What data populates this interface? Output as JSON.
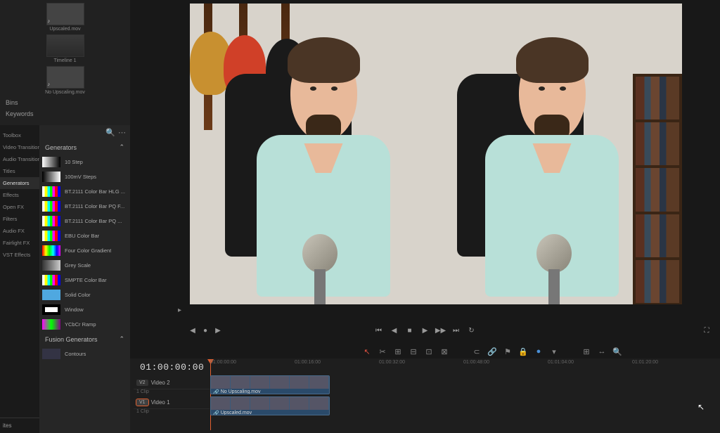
{
  "media_pool": {
    "items": [
      {
        "name": "Upscaled.mov",
        "type": "video"
      },
      {
        "name": "Timeline 1",
        "type": "timeline"
      },
      {
        "name": "No Upscaling.mov",
        "type": "video"
      }
    ]
  },
  "filters": {
    "bins": "Bins",
    "keywords": "Keywords"
  },
  "categories": [
    "Toolbox",
    "Video Transitions",
    "Audio Transitions",
    "Titles",
    "Generators",
    "Effects",
    "Open FX",
    "Filters",
    "Audio FX",
    "Fairlight FX",
    "VST Effects"
  ],
  "active_category": "Generators",
  "generators_header": "Generators",
  "fusion_gen_header": "Fusion Generators",
  "contours_item": "Contours",
  "bottom_tab": "ites",
  "generators": [
    {
      "label": "10 Step",
      "swatch": "swatch-10step"
    },
    {
      "label": "100mV Steps",
      "swatch": "swatch-100mv"
    },
    {
      "label": "BT.2111 Color Bar HLG ...",
      "swatch": "swatch-bars"
    },
    {
      "label": "BT.2111 Color Bar PQ F...",
      "swatch": "swatch-bars"
    },
    {
      "label": "BT.2111 Color Bar PQ ...",
      "swatch": "swatch-bars"
    },
    {
      "label": "EBU Color Bar",
      "swatch": "swatch-bars"
    },
    {
      "label": "Four Color Gradient",
      "swatch": "swatch-gradient"
    },
    {
      "label": "Grey Scale",
      "swatch": "swatch-grey"
    },
    {
      "label": "SMPTE Color Bar",
      "swatch": "swatch-bars"
    },
    {
      "label": "Solid Color",
      "swatch": "swatch-solid"
    },
    {
      "label": "Window",
      "swatch": "swatch-window"
    },
    {
      "label": "YCbCr Ramp",
      "swatch": "swatch-ycocg"
    }
  ],
  "timecode": "01:00:00:00",
  "tracks": {
    "v2": {
      "badge": "V2",
      "name": "Video 2",
      "sub": "1 Clip"
    },
    "v1": {
      "badge": "V1",
      "name": "Video 1",
      "sub": "1 Clip"
    }
  },
  "clips": {
    "top": "No Upscaling.mov",
    "bottom": "Upscaled.mov"
  },
  "ruler": [
    "01:00:00:00",
    "01:00:16:00",
    "01:00:32:00",
    "01:00:48:00",
    "01:01:04:00",
    "01:01:20:00"
  ],
  "icons": {
    "search": "🔍",
    "more": "⋯",
    "chevron": "⌃",
    "link": "🔗",
    "arrow": "▶",
    "first": "⏮",
    "prev": "◀",
    "stop": "■",
    "play": "▶",
    "next": "▶▶",
    "last": "⏭",
    "loop": "↻",
    "pointer": "↖",
    "magnet": "⊂",
    "marker": "●",
    "expand": "⛶",
    "jog_l": "◀",
    "jog_r": "▶",
    "jog_dot": "●"
  }
}
